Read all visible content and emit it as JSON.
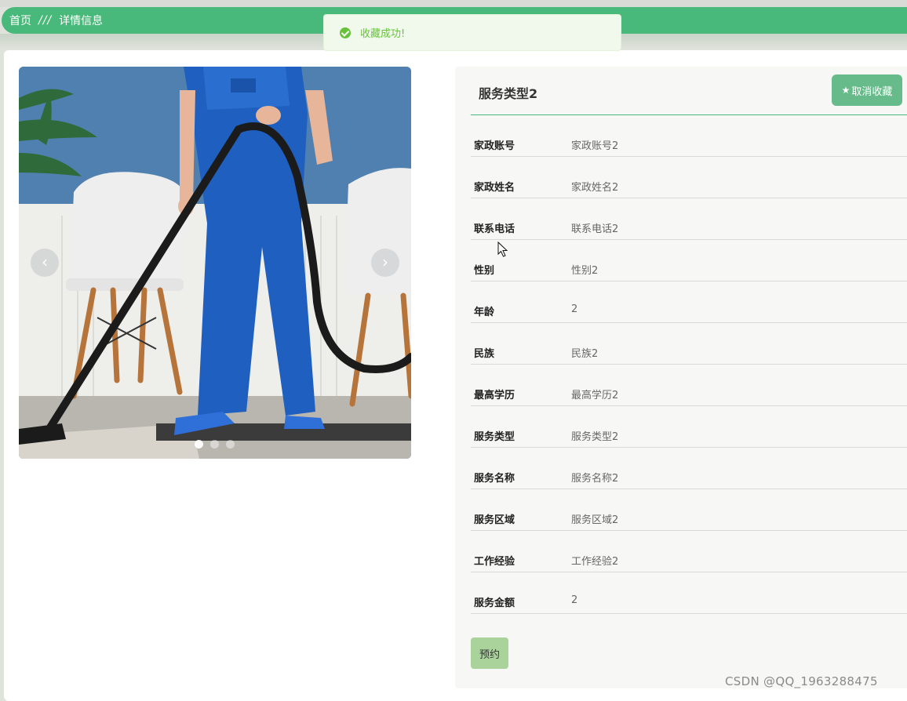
{
  "breadcrumb": {
    "home": "首页",
    "separator": "///",
    "current": "详情信息"
  },
  "toast": {
    "message": "收藏成功!",
    "icon": "success-check-icon"
  },
  "carousel": {
    "prev_arrow": "‹",
    "next_arrow": "›",
    "slide_count": 3,
    "active_slide": 1
  },
  "detail": {
    "title": "服务类型2",
    "favorite_button_icon": "★",
    "favorite_button": "取消收藏",
    "fields": [
      {
        "label": "家政账号",
        "value": "家政账号2"
      },
      {
        "label": "家政姓名",
        "value": "家政姓名2"
      },
      {
        "label": "联系电话",
        "value": "联系电话2"
      },
      {
        "label": "性别",
        "value": "性别2"
      },
      {
        "label": "年龄",
        "value": "2"
      },
      {
        "label": "民族",
        "value": "民族2"
      },
      {
        "label": "最高学历",
        "value": "最高学历2"
      },
      {
        "label": "服务类型",
        "value": "服务类型2"
      },
      {
        "label": "服务名称",
        "value": "服务名称2"
      },
      {
        "label": "服务区域",
        "value": "服务区域2"
      },
      {
        "label": "工作经验",
        "value": "工作经验2"
      },
      {
        "label": "服务金额",
        "value": "2"
      }
    ],
    "book_button": "预约"
  },
  "watermark": "CSDN @QQ_1963288475",
  "colors": {
    "accent": "#48b97a",
    "toast_bg": "#f0f9eb",
    "toast_text": "#67c23a",
    "favorite_button": "#67bb8a",
    "book_button": "#a9d39b"
  }
}
